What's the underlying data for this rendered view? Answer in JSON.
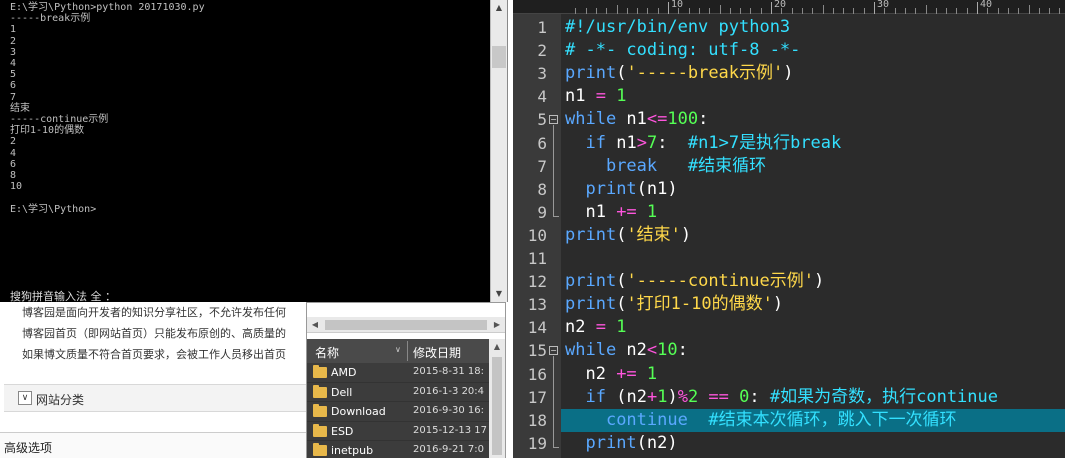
{
  "console": {
    "lines": [
      "E:\\学习\\Python>python 20171030.py",
      "-----break示例",
      "1",
      "2",
      "3",
      "4",
      "5",
      "6",
      "7",
      "结束",
      "-----continue示例",
      "打印1-10的偶数",
      "2",
      "4",
      "6",
      "8",
      "10",
      "",
      "E:\\学习\\Python>"
    ],
    "ime_status": "搜狗拼音输入法 全 ："
  },
  "blog": {
    "lines": [
      "博客园是面向开发者的知识分享社区，不允许发布任何",
      "博客园首页（即网站首页）只能发布原创的、高质量的",
      "如果博文质量不符合首页要求，会被工作人员移出首页"
    ],
    "site_category": "网站分类",
    "advanced_options": "高级选项"
  },
  "explorer": {
    "columns": {
      "name": "名称",
      "date": "修改日期"
    },
    "rows": [
      {
        "name": "AMD",
        "date": "2015-8-31 18:"
      },
      {
        "name": "Dell",
        "date": "2016-1-3 20:4"
      },
      {
        "name": "Download",
        "date": "2016-9-30 16:"
      },
      {
        "name": "ESD",
        "date": "2015-12-13 17"
      },
      {
        "name": "inetpub",
        "date": "2016-9-21 7:0"
      }
    ]
  },
  "editor": {
    "ruler_labels": [
      "10",
      "20",
      "30",
      "40"
    ],
    "line_numbers": [
      "1",
      "2",
      "3",
      "4",
      "5",
      "6",
      "7",
      "8",
      "9",
      "10",
      "11",
      "12",
      "13",
      "14",
      "15",
      "16",
      "17",
      "18",
      "19"
    ],
    "highlighted_line": 18,
    "fold_markers": [
      "5",
      "15"
    ],
    "code": [
      [
        [
          "c-cm",
          "#!/usr/bin/env python3"
        ]
      ],
      [
        [
          "c-cm",
          "# -*- coding: utf-8 -*-"
        ]
      ],
      [
        [
          "c-kw",
          "print"
        ],
        [
          "c-br",
          "("
        ],
        [
          "c-str",
          "'-----break示例'"
        ],
        [
          "c-br",
          ")"
        ]
      ],
      [
        [
          "c-id",
          "n1 "
        ],
        [
          "c-op",
          "="
        ],
        [
          "c-num",
          " 1"
        ]
      ],
      [
        [
          "c-kw",
          "while"
        ],
        [
          "c-id",
          " n1"
        ],
        [
          "c-op",
          "<="
        ],
        [
          "c-num",
          "100"
        ],
        [
          "c-br",
          ":"
        ]
      ],
      [
        [
          "c-id",
          "  "
        ],
        [
          "c-kw",
          "if"
        ],
        [
          "c-id",
          " n1"
        ],
        [
          "c-op",
          ">"
        ],
        [
          "c-num",
          "7"
        ],
        [
          "c-br",
          ":  "
        ],
        [
          "c-cm",
          "#n1>7是执行break"
        ]
      ],
      [
        [
          "c-id",
          "    "
        ],
        [
          "c-kw",
          "break"
        ],
        [
          "c-id",
          "   "
        ],
        [
          "c-cm",
          "#结束循环"
        ]
      ],
      [
        [
          "c-id",
          "  "
        ],
        [
          "c-kw",
          "print"
        ],
        [
          "c-br",
          "("
        ],
        [
          "c-id",
          "n1"
        ],
        [
          "c-br",
          ")"
        ]
      ],
      [
        [
          "c-id",
          "  n1 "
        ],
        [
          "c-op",
          "+="
        ],
        [
          "c-num",
          " 1"
        ]
      ],
      [
        [
          "c-kw",
          "print"
        ],
        [
          "c-br",
          "("
        ],
        [
          "c-str",
          "'结束'"
        ],
        [
          "c-br",
          ")"
        ]
      ],
      [],
      [
        [
          "c-kw",
          "print"
        ],
        [
          "c-br",
          "("
        ],
        [
          "c-str",
          "'-----continue示例'"
        ],
        [
          "c-br",
          ")"
        ]
      ],
      [
        [
          "c-kw",
          "print"
        ],
        [
          "c-br",
          "("
        ],
        [
          "c-str",
          "'打印1-10的偶数'"
        ],
        [
          "c-br",
          ")"
        ]
      ],
      [
        [
          "c-id",
          "n2 "
        ],
        [
          "c-op",
          "="
        ],
        [
          "c-num",
          " 1"
        ]
      ],
      [
        [
          "c-kw",
          "while"
        ],
        [
          "c-id",
          " n2"
        ],
        [
          "c-op",
          "<"
        ],
        [
          "c-num",
          "10"
        ],
        [
          "c-br",
          ":"
        ]
      ],
      [
        [
          "c-id",
          "  n2 "
        ],
        [
          "c-op",
          "+="
        ],
        [
          "c-num",
          " 1"
        ]
      ],
      [
        [
          "c-id",
          "  "
        ],
        [
          "c-kw",
          "if"
        ],
        [
          "c-br",
          " ("
        ],
        [
          "c-id",
          "n2"
        ],
        [
          "c-op",
          "+"
        ],
        [
          "c-num",
          "1"
        ],
        [
          "c-br",
          ")"
        ],
        [
          "c-op",
          "%"
        ],
        [
          "c-num",
          "2"
        ],
        [
          "c-op",
          " =="
        ],
        [
          "c-num",
          " 0"
        ],
        [
          "c-br",
          ": "
        ],
        [
          "c-cm",
          "#如果为奇数，执行continue"
        ]
      ],
      [
        [
          "c-id",
          "    "
        ],
        [
          "c-kw",
          "continue"
        ],
        [
          "c-id",
          "  "
        ],
        [
          "c-cm",
          "#结束本次循环，跳入下一次循环"
        ]
      ],
      [
        [
          "c-id",
          "  "
        ],
        [
          "c-kw",
          "print"
        ],
        [
          "c-br",
          "("
        ],
        [
          "c-id",
          "n2"
        ],
        [
          "c-br",
          ")"
        ]
      ]
    ]
  }
}
